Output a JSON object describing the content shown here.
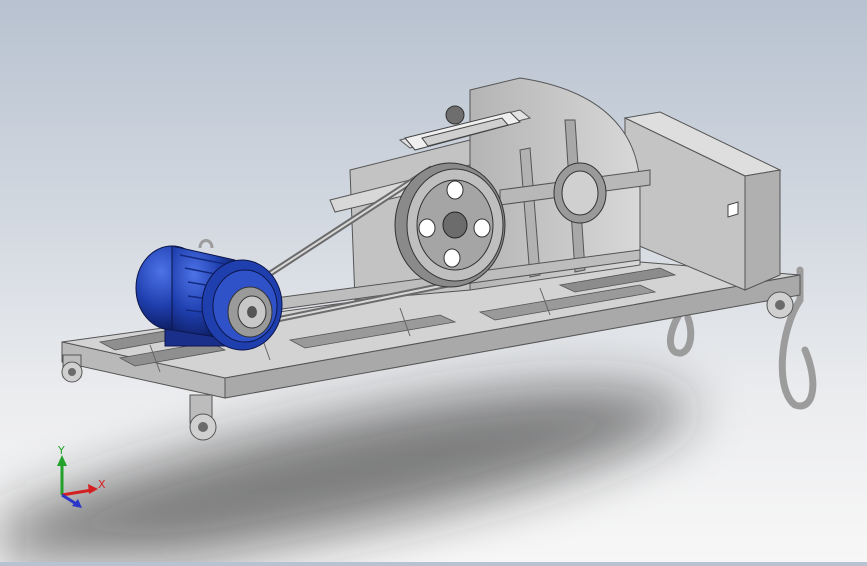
{
  "viewport": {
    "background_top": "#b8c2d0",
    "background_bottom": "#f7f7f7"
  },
  "model": {
    "motor_color": "#1f3fae",
    "body_color": "#c9c9c9",
    "shadow_color": "#1e1e1e"
  },
  "triad": {
    "x_label": "X",
    "y_label": "Y",
    "x_color": "#d42020",
    "y_color": "#22a22a",
    "z_color": "#2a36c8"
  }
}
